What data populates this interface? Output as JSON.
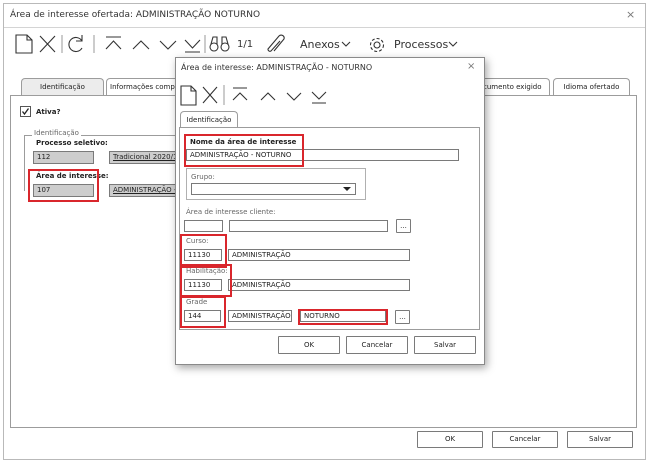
{
  "main_window": {
    "title": "Área de interesse ofertada: ADMINISTRAÇÃO NOTURNO",
    "close": "×",
    "toolbar": {
      "page_indicator": "1/1",
      "anexos": "Anexos",
      "processos": "Processos"
    },
    "tabs": [
      "Identificação",
      "Informações comp",
      "cumento exigido",
      "Idioma ofertado"
    ],
    "ativo_label": "Ativa?",
    "identificacao_legend": "Identificação",
    "processo_seletivo_label": "Processo seletivo:",
    "processo_seletivo_code": "112",
    "processo_seletivo_name": "Tradicional 2020/1",
    "area_interesse_label": "Área de interesse:",
    "area_interesse_code": "107",
    "area_interesse_name": "ADMINISTRAÇÃO - N",
    "buttons": {
      "ok": "OK",
      "cancel": "Cancelar",
      "save": "Salvar"
    }
  },
  "dialog": {
    "title": "Área de interesse: ADMINISTRAÇÃO - NOTURNO",
    "close": "×",
    "tab": "Identificação",
    "nome_label": "Nome da área de interesse",
    "nome_value": "ADMINISTRAÇÃO - NOTURNO",
    "grupo_label": "Grupo:",
    "grupo_value": "",
    "area_cliente_label": "Área de interesse cliente:",
    "area_cliente_code": "",
    "area_cliente_name": "",
    "ellipsis": "...",
    "curso_label": "Curso:",
    "curso_code": "11130",
    "curso_name": "ADMINISTRAÇÃO",
    "habilitacao_label": "Habilitação:",
    "habilitacao_code": "11130",
    "habilitacao_name": "ADMINISTRAÇÃO",
    "grade_label": "Grade",
    "grade_code": "144",
    "grade_name": "ADMINISTRAÇÃO",
    "grade_turno": "NOTURNO",
    "buttons": {
      "ok": "OK",
      "cancel": "Cancelar",
      "save": "Salvar"
    }
  },
  "colors": {
    "highlight": "#d9262c",
    "readonly_field": "#cdcdcd"
  }
}
